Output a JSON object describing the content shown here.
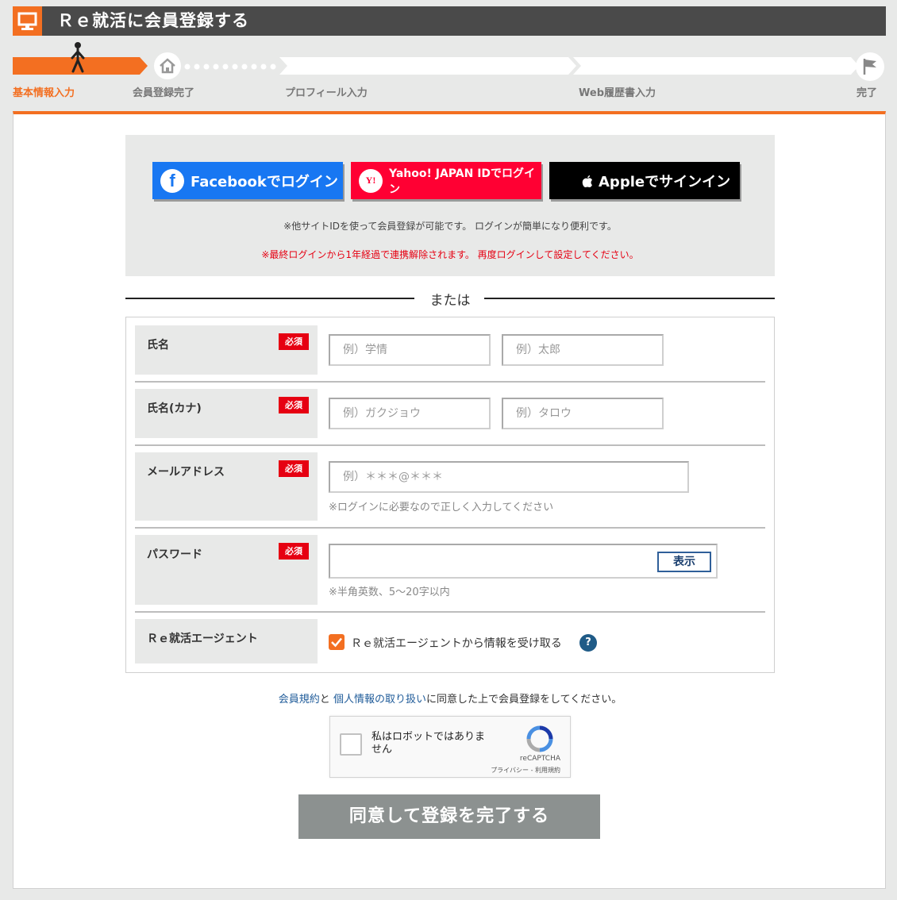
{
  "header": {
    "title": "Ｒｅ就活に会員登録する",
    "accent": "#f36f21"
  },
  "steps": [
    {
      "label": "基本情報入力",
      "active": true
    },
    {
      "label": "会員登録完了",
      "active": false
    },
    {
      "label": "プロフィール入力",
      "active": false
    },
    {
      "label": "Web履歴書入力",
      "active": false
    },
    {
      "label": "完了",
      "active": false
    }
  ],
  "social": {
    "facebook_label": "Facebookでログイン",
    "yahoo_label": "Yahoo! JAPAN IDでログイン",
    "yahoo_logo": "Y!",
    "apple_label": "Appleでサインイン",
    "note": "※他サイトIDを使って会員登録が可能です。 ログインが簡単になり便利です。",
    "warning": "※最終ログインから1年経過で連携解除されます。 再度ログインして設定してください。"
  },
  "divider": {
    "text": "または"
  },
  "form": {
    "required_badge": "必須",
    "name": {
      "label": "氏名",
      "last_placeholder": "例）学情",
      "first_placeholder": "例）太郎"
    },
    "kana": {
      "label": "氏名(カナ)",
      "last_placeholder": "例）ガクジョウ",
      "first_placeholder": "例）タロウ"
    },
    "email": {
      "label": "メールアドレス",
      "placeholder": "例）＊＊＊@＊＊＊",
      "hint": "※ログインに必要なので正しく入力してください"
    },
    "password": {
      "label": "パスワード",
      "show_label": "表示",
      "hint": "※半角英数、5〜20字以内"
    },
    "agent": {
      "label": "Ｒｅ就活エージェント",
      "checkbox_label": "Ｒｅ就活エージェントから情報を受け取る",
      "checked": true,
      "help": "?"
    }
  },
  "terms": {
    "link1": "会員規約",
    "sep": "と",
    "link2": "個人情報の取り扱い",
    "rest": "に同意した上で会員登録をしてください。"
  },
  "captcha": {
    "label": "私はロボットではありません",
    "brand": "reCAPTCHA",
    "links": "プライバシー - 利用規約"
  },
  "submit": {
    "label": "同意して登録を完了する"
  }
}
